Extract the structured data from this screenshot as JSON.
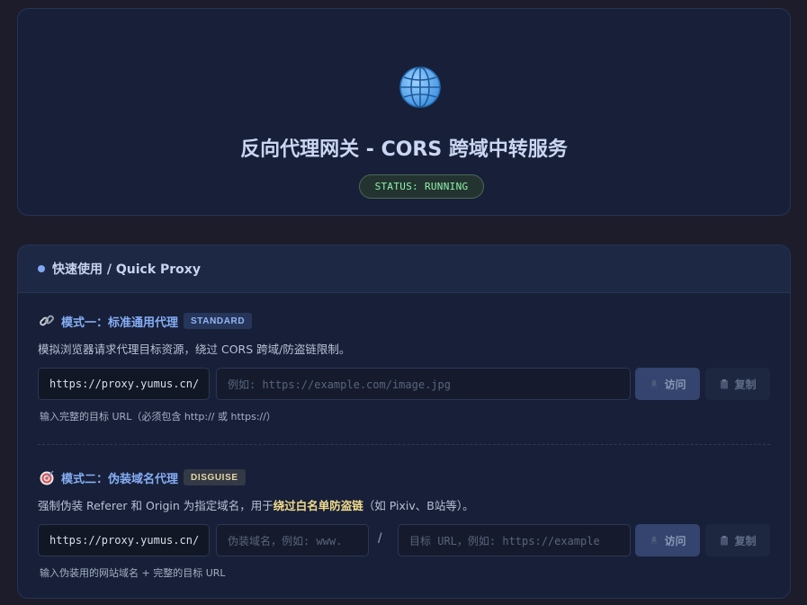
{
  "header": {
    "icon": "globe-icon",
    "title": "反向代理网关 - CORS 跨域中转服务",
    "status": "STATUS: RUNNING"
  },
  "card": {
    "title": "快速使用 / Quick Proxy",
    "mode1": {
      "icon": "link-icon",
      "title": "模式一：标准通用代理",
      "badge": "STANDARD",
      "description": "模拟浏览器请求代理目标资源，绕过 CORS 跨域/防盗链限制。",
      "prefix": "https://proxy.yumus.cn/",
      "placeholder": "例如: https://example.com/image.jpg",
      "visit_label": "访问",
      "copy_label": "复制",
      "hint": "输入完整的目标 URL（必须包含 http:// 或 https://）"
    },
    "mode2": {
      "icon": "target-icon",
      "title": "模式二：伪装域名代理",
      "badge": "DISGUISE",
      "description_before": "强制伪装 Referer 和 Origin 为指定域名，用于",
      "description_highlight": "绕过白名单防盗链",
      "description_after": "（如 Pixiv、B站等）。",
      "prefix": "https://proxy.yumus.cn/",
      "domain_placeholder": "伪装域名，例如: www.",
      "separator": "/",
      "url_placeholder": "目标 URL，例如: https://example",
      "visit_label": "访问",
      "copy_label": "复制",
      "hint": "输入伪装用的网站域名 + 完整的目标 URL"
    }
  },
  "colors": {
    "background": "#1c1c2a",
    "panel": "#172038",
    "accent": "#86adf5",
    "status_green": "#8ff0ac",
    "highlight": "#f3dc8c"
  }
}
